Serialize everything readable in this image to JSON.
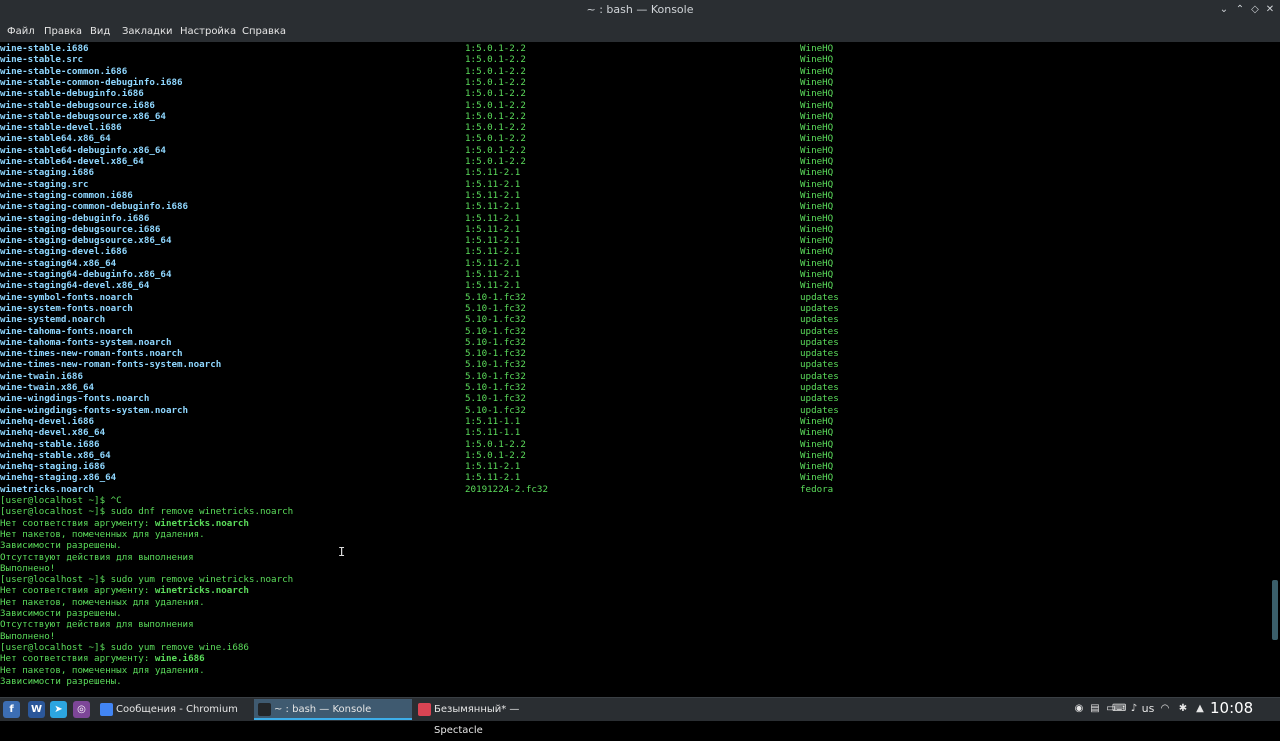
{
  "window": {
    "title": "~ : bash — Konsole",
    "controls": [
      "⌄",
      "⌃",
      "◇",
      "✕"
    ]
  },
  "menu": [
    "Файл",
    "Правка",
    "Вид",
    "Закладки",
    "Настройка",
    "Справка"
  ],
  "packages": [
    [
      "wine-stable.i686",
      "1:5.0.1-2.2",
      "WineHQ"
    ],
    [
      "wine-stable.src",
      "1:5.0.1-2.2",
      "WineHQ"
    ],
    [
      "wine-stable-common.i686",
      "1:5.0.1-2.2",
      "WineHQ"
    ],
    [
      "wine-stable-common-debuginfo.i686",
      "1:5.0.1-2.2",
      "WineHQ"
    ],
    [
      "wine-stable-debuginfo.i686",
      "1:5.0.1-2.2",
      "WineHQ"
    ],
    [
      "wine-stable-debugsource.i686",
      "1:5.0.1-2.2",
      "WineHQ"
    ],
    [
      "wine-stable-debugsource.x86_64",
      "1:5.0.1-2.2",
      "WineHQ"
    ],
    [
      "wine-stable-devel.i686",
      "1:5.0.1-2.2",
      "WineHQ"
    ],
    [
      "wine-stable64.x86_64",
      "1:5.0.1-2.2",
      "WineHQ"
    ],
    [
      "wine-stable64-debuginfo.x86_64",
      "1:5.0.1-2.2",
      "WineHQ"
    ],
    [
      "wine-stable64-devel.x86_64",
      "1:5.0.1-2.2",
      "WineHQ"
    ],
    [
      "wine-staging.i686",
      "1:5.11-2.1",
      "WineHQ"
    ],
    [
      "wine-staging.src",
      "1:5.11-2.1",
      "WineHQ"
    ],
    [
      "wine-staging-common.i686",
      "1:5.11-2.1",
      "WineHQ"
    ],
    [
      "wine-staging-common-debuginfo.i686",
      "1:5.11-2.1",
      "WineHQ"
    ],
    [
      "wine-staging-debuginfo.i686",
      "1:5.11-2.1",
      "WineHQ"
    ],
    [
      "wine-staging-debugsource.i686",
      "1:5.11-2.1",
      "WineHQ"
    ],
    [
      "wine-staging-debugsource.x86_64",
      "1:5.11-2.1",
      "WineHQ"
    ],
    [
      "wine-staging-devel.i686",
      "1:5.11-2.1",
      "WineHQ"
    ],
    [
      "wine-staging64.x86_64",
      "1:5.11-2.1",
      "WineHQ"
    ],
    [
      "wine-staging64-debuginfo.x86_64",
      "1:5.11-2.1",
      "WineHQ"
    ],
    [
      "wine-staging64-devel.x86_64",
      "1:5.11-2.1",
      "WineHQ"
    ],
    [
      "wine-symbol-fonts.noarch",
      "5.10-1.fc32",
      "updates"
    ],
    [
      "wine-system-fonts.noarch",
      "5.10-1.fc32",
      "updates"
    ],
    [
      "wine-systemd.noarch",
      "5.10-1.fc32",
      "updates"
    ],
    [
      "wine-tahoma-fonts.noarch",
      "5.10-1.fc32",
      "updates"
    ],
    [
      "wine-tahoma-fonts-system.noarch",
      "5.10-1.fc32",
      "updates"
    ],
    [
      "wine-times-new-roman-fonts.noarch",
      "5.10-1.fc32",
      "updates"
    ],
    [
      "wine-times-new-roman-fonts-system.noarch",
      "5.10-1.fc32",
      "updates"
    ],
    [
      "wine-twain.i686",
      "5.10-1.fc32",
      "updates"
    ],
    [
      "wine-twain.x86_64",
      "5.10-1.fc32",
      "updates"
    ],
    [
      "wine-wingdings-fonts.noarch",
      "5.10-1.fc32",
      "updates"
    ],
    [
      "wine-wingdings-fonts-system.noarch",
      "5.10-1.fc32",
      "updates"
    ],
    [
      "winehq-devel.i686",
      "1:5.11-1.1",
      "WineHQ"
    ],
    [
      "winehq-devel.x86_64",
      "1:5.11-1.1",
      "WineHQ"
    ],
    [
      "winehq-stable.i686",
      "1:5.0.1-2.2",
      "WineHQ"
    ],
    [
      "winehq-stable.x86_64",
      "1:5.0.1-2.2",
      "WineHQ"
    ],
    [
      "winehq-staging.i686",
      "1:5.11-2.1",
      "WineHQ"
    ],
    [
      "winehq-staging.x86_64",
      "1:5.11-2.1",
      "WineHQ"
    ],
    [
      "winetricks.noarch",
      "20191224-2.fc32",
      "fedora"
    ]
  ],
  "output": [
    {
      "text": "[user@localhost ~]$ ^C"
    },
    {
      "text": "[user@localhost ~]$ sudo dnf remove winetricks.noarch"
    },
    {
      "text": "Нет соответствия аргументу: ",
      "bold": "winetricks.noarch"
    },
    {
      "text": "Нет пакетов, помеченных для удаления."
    },
    {
      "text": "Зависимости разрешены."
    },
    {
      "text": "Отсутствуют действия для выполнения"
    },
    {
      "text": "Выполнено!"
    },
    {
      "text": "[user@localhost ~]$ sudo yum remove winetricks.noarch"
    },
    {
      "text": "Нет соответствия аргументу: ",
      "bold": "winetricks.noarch"
    },
    {
      "text": "Нет пакетов, помеченных для удаления."
    },
    {
      "text": "Зависимости разрешены."
    },
    {
      "text": "Отсутствуют действия для выполнения"
    },
    {
      "text": "Выполнено!"
    },
    {
      "text": "[user@localhost ~]$ sudo yum remove wine.i686"
    },
    {
      "text": "Нет соответствия аргументу: ",
      "bold": "wine.i686"
    },
    {
      "text": "Нет пакетов, помеченных для удаления."
    },
    {
      "text": "Зависимости разрешены."
    }
  ],
  "taskbar": {
    "launchers": [
      {
        "name": "fedora-menu-icon",
        "glyph": "f",
        "color": "#3c6eb4"
      },
      {
        "name": "word-icon",
        "glyph": "W",
        "color": "#2b579a"
      },
      {
        "name": "telegram-icon",
        "glyph": "➤",
        "color": "#2ca5e0"
      },
      {
        "name": "tor-browser-icon",
        "glyph": "◎",
        "color": "#7d4698"
      }
    ],
    "tasks": [
      {
        "name": "task-chromium",
        "label": "Сообщения - Chromium",
        "active": false,
        "color": "#4285f4"
      },
      {
        "name": "task-konsole",
        "label": "~ : bash — Konsole",
        "active": true,
        "color": "#232629"
      },
      {
        "name": "task-spectacle",
        "label": "Безымянный* — Spectacle",
        "active": false,
        "color": "#da4453"
      }
    ],
    "tray": [
      {
        "name": "tray-badge-icon",
        "glyph": "◉"
      },
      {
        "name": "clipboard-icon",
        "glyph": "▤"
      },
      {
        "name": "battery-icon",
        "glyph": "▭"
      },
      {
        "name": "keyboard-icon",
        "glyph": "⌨"
      },
      {
        "name": "volume-icon",
        "glyph": "♪"
      }
    ],
    "tray2": [
      {
        "name": "wifi-icon",
        "glyph": "◠"
      },
      {
        "name": "bluetooth-icon",
        "glyph": "✱"
      },
      {
        "name": "expand-tray-icon",
        "glyph": "▲"
      }
    ],
    "layout": "us",
    "clock": "10:08"
  }
}
